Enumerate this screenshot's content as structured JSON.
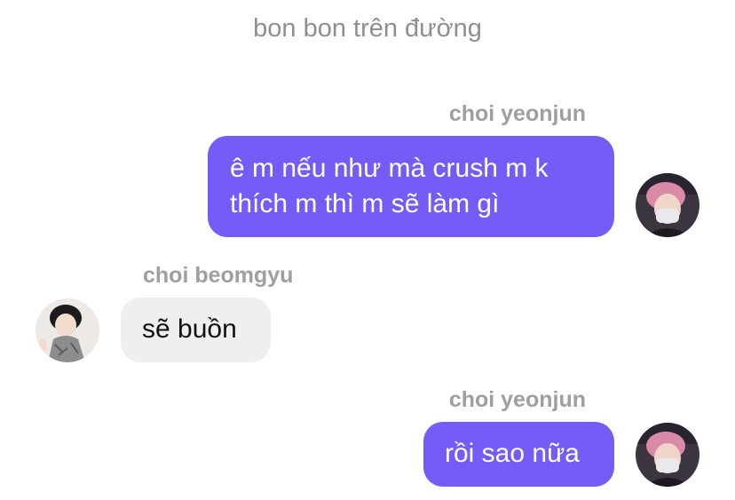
{
  "chat": {
    "title": "bon bon trên đường"
  },
  "messages": [
    {
      "sender": "choi yeonjun",
      "text": "ê m nếu như mà crush m k thích m thì m sẽ làm gì",
      "direction": "outgoing"
    },
    {
      "sender": "choi beomgyu",
      "text": "sẽ buồn",
      "direction": "incoming"
    },
    {
      "sender": "choi yeonjun",
      "text": "rồi sao nữa",
      "direction": "outgoing"
    }
  ],
  "colors": {
    "outgoing_bubble": "#755cf6",
    "incoming_bubble": "#efefef",
    "meta_text": "#8e8e93"
  }
}
